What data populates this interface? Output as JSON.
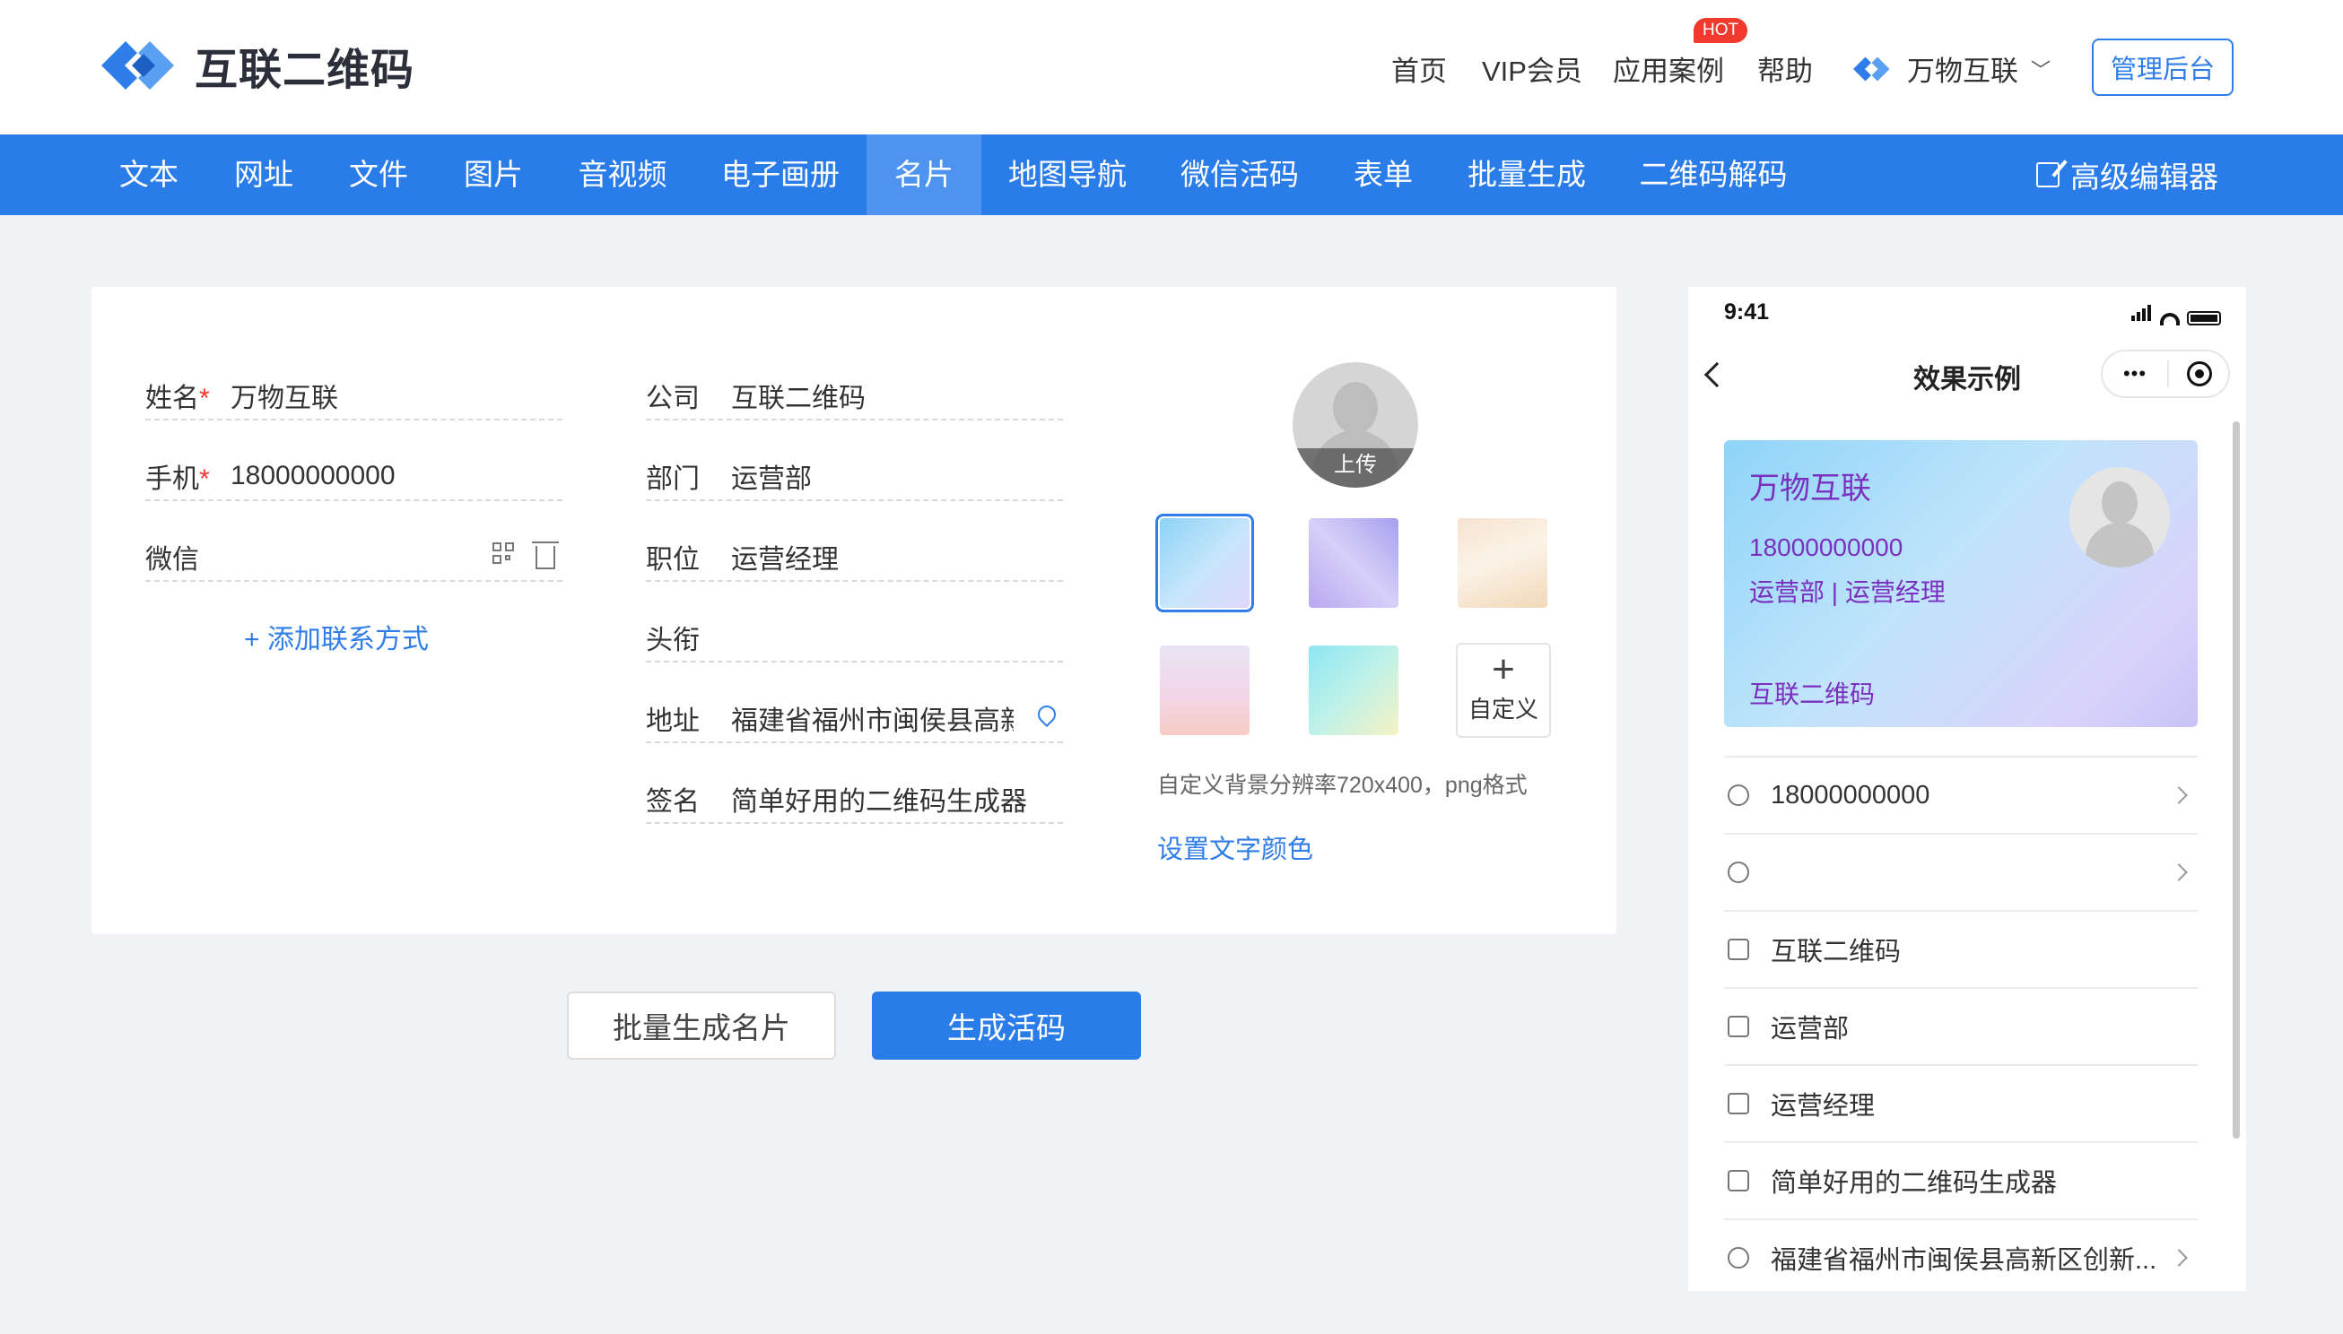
{
  "header": {
    "logo_text": "互联二维码",
    "nav": [
      "首页",
      "VIP会员",
      "应用案例",
      "帮助"
    ],
    "hot_badge": "HOT",
    "brand": "万物互联",
    "admin_button": "管理后台"
  },
  "tabs": {
    "items": [
      "文本",
      "网址",
      "文件",
      "图片",
      "音视频",
      "电子画册",
      "名片",
      "地图导航",
      "微信活码",
      "表单",
      "批量生成",
      "二维码解码"
    ],
    "active": "名片",
    "advanced_editor": "高级编辑器"
  },
  "form": {
    "name": {
      "label": "姓名",
      "required": "*",
      "value": "万物互联"
    },
    "mobile": {
      "label": "手机",
      "required": "*",
      "value": "18000000000"
    },
    "wechat": {
      "label": "微信",
      "value": ""
    },
    "add_contact": "+ 添加联系方式",
    "company": {
      "label": "公司",
      "value": "互联二维码"
    },
    "department": {
      "label": "部门",
      "value": "运营部"
    },
    "position": {
      "label": "职位",
      "value": "运营经理"
    },
    "title": {
      "label": "头衔",
      "value": ""
    },
    "address": {
      "label": "地址",
      "value": "福建省福州市闽侯县高新区"
    },
    "signature": {
      "label": "签名",
      "value": "简单好用的二维码生成器"
    },
    "avatar_upload": "上传",
    "custom_bg": "自定义",
    "custom_bg_plus": "+",
    "bg_hint": "自定义背景分辨率720x400，png格式",
    "text_color_link": "设置文字颜色"
  },
  "actions": {
    "batch": "批量生成名片",
    "generate": "生成活码"
  },
  "preview": {
    "time": "9:41",
    "title": "效果示例",
    "capsule_dots": "•••",
    "card": {
      "name": "万物互联",
      "phone": "18000000000",
      "role": "运营部 | 运营经理",
      "company": "互联二维码"
    },
    "rows": [
      {
        "icon": "phone-icon",
        "text": "18000000000"
      },
      {
        "icon": "wechat-icon",
        "text": ""
      },
      {
        "icon": "building-icon",
        "text": "互联二维码"
      },
      {
        "icon": "org-icon",
        "text": "运营部"
      },
      {
        "icon": "id-card-icon",
        "text": "运营经理"
      },
      {
        "icon": "signature-icon",
        "text": "简单好用的二维码生成器"
      },
      {
        "icon": "location-icon",
        "text": "福建省福州市闽侯县高新区创新..."
      }
    ]
  },
  "colors": {
    "primary": "#2a7de8",
    "required": "#f03a2e",
    "card_text": "#7b2fbf"
  }
}
